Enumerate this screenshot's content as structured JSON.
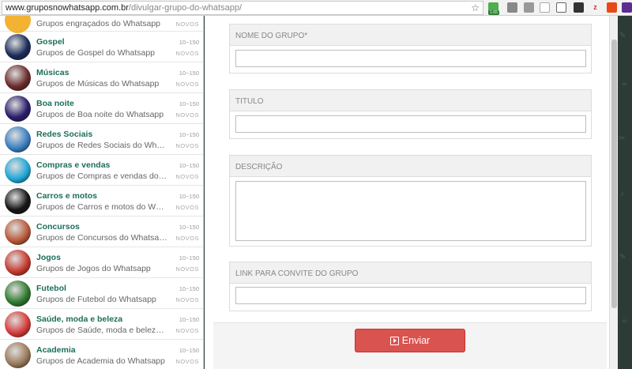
{
  "browser": {
    "url_domain": "www.gruposnowhatsapp.com.br",
    "url_path": "/divulgar-grupo-do-whatsapp/",
    "ext_badge": "1.65"
  },
  "sidebar": {
    "top_partial_desc": "Grupos engraçados do Whatsapp",
    "top_partial_badge": "NOVOS",
    "items": [
      {
        "name": "Gospel",
        "desc": "Grupos de Gospel do Whatsapp",
        "range": "10~150",
        "badge": "NOVOS",
        "color": "#1b2c5a"
      },
      {
        "name": "Músicas",
        "desc": "Grupos de Músicas do Whatsapp",
        "range": "10~150",
        "badge": "NOVOS",
        "color": "#6b2b2b"
      },
      {
        "name": "Boa noite",
        "desc": "Grupos de Boa noite do Whatsapp",
        "range": "10~150",
        "badge": "NOVOS",
        "color": "#2a1d6b"
      },
      {
        "name": "Redes Sociais",
        "desc": "Grupos de Redes Sociais do Whatsapp",
        "range": "10~150",
        "badge": "NOVOS",
        "color": "#3a7fc2"
      },
      {
        "name": "Compras e vendas",
        "desc": "Grupos de Compras e vendas do Whatsapp",
        "range": "10~150",
        "badge": "NOVOS",
        "color": "#1fa7d8"
      },
      {
        "name": "Carros e motos",
        "desc": "Grupos de Carros e motos do Whatsapp",
        "range": "10~150",
        "badge": "NOVOS",
        "color": "#151515"
      },
      {
        "name": "Concursos",
        "desc": "Grupos de Concursos do Whatsapp",
        "range": "10~150",
        "badge": "NOVOS",
        "color": "#b85a3a"
      },
      {
        "name": "Jogos",
        "desc": "Grupos de Jogos do Whatsapp",
        "range": "10~150",
        "badge": "NOVOS",
        "color": "#c73a2f"
      },
      {
        "name": "Futebol",
        "desc": "Grupos de Futebol do Whatsapp",
        "range": "10~150",
        "badge": "NOVOS",
        "color": "#2f7a2f"
      },
      {
        "name": "Saúde, moda e beleza",
        "desc": "Grupos de Saúde, moda e beleza do Whatsapp",
        "range": "10~150",
        "badge": "NOVOS",
        "color": "#d63b3b"
      },
      {
        "name": "Academia",
        "desc": "Grupos de Academia do Whatsapp",
        "range": "10~150",
        "badge": "NOVOS",
        "color": "#9a7a5a"
      }
    ]
  },
  "form": {
    "group_name_label": "NOME DO GRUPO*",
    "title_label": "TITULO",
    "description_label": "DESCRIÇÃO",
    "invite_link_label": "LINK PARA CONVITE DO GRUPO",
    "group_name_value": "",
    "title_value": "",
    "description_value": "",
    "invite_link_value": "",
    "submit_label": "Enviar"
  }
}
